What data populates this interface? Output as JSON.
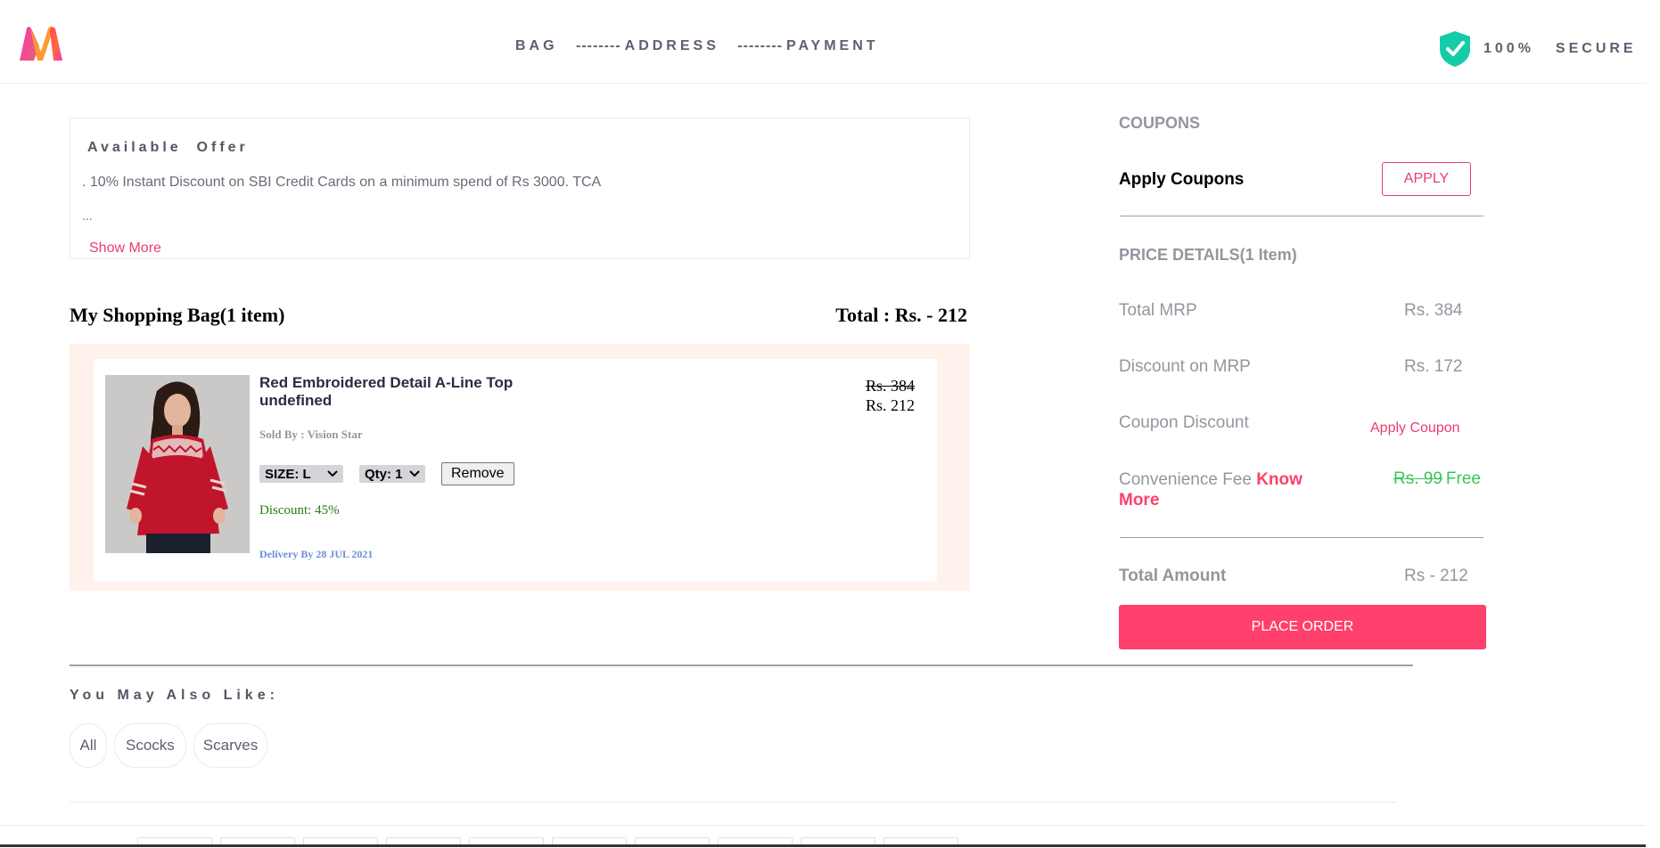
{
  "header": {
    "steps": [
      {
        "label": "BAG"
      },
      {
        "label": "ADDRESS"
      },
      {
        "label": "PAYMENT"
      }
    ],
    "step_separator": "--------",
    "secure_percent": "100%",
    "secure_text": "SECURE",
    "colors": {
      "brand_pink": "#ff3f6c",
      "shield": "#14cda8"
    }
  },
  "offer": {
    "title": "Available  Offer",
    "line": ". 10% Instant Discount on SBI Credit Cards on a minimum spend of Rs 3000. TCA",
    "ellipsis": "...",
    "show_more": "Show More"
  },
  "bag": {
    "heading": "My Shopping Bag(1 item)",
    "total": "Total : Rs. - 212"
  },
  "item": {
    "name": "Red Embroidered Detail A-Line Top undefined",
    "sold_by": "Sold By : Vision Star",
    "size": "SIZE: L",
    "qty": "Qty: 1",
    "remove": "Remove",
    "discount": "Discount: 45%",
    "delivery": "Delivery By 28 JUL 2021",
    "price_old": "Rs. 384",
    "price_new": "Rs. 212"
  },
  "summary": {
    "coupons_title": "COUPONS",
    "apply_coupons_label": "Apply Coupons",
    "apply_button": "APPLY",
    "price_details_title": "PRICE DETAILS(1 Item)",
    "rows": [
      {
        "label": "Total MRP",
        "value": "Rs. 384"
      },
      {
        "label": "Discount on MRP",
        "value": "Rs. 172"
      },
      {
        "label": "Coupon Discount",
        "value": "Apply Coupon"
      }
    ],
    "convenience_label": "Convenience Fee",
    "know_more": "Know More",
    "convenience_old": "Rs. 99",
    "convenience_free": "Free",
    "total_label": "Total Amount",
    "total_value": "Rs - 212",
    "place_order": "PLACE ORDER"
  },
  "also_like": {
    "title": "You May Also Like:",
    "chips": [
      "All",
      "Scocks",
      "Scarves"
    ]
  }
}
